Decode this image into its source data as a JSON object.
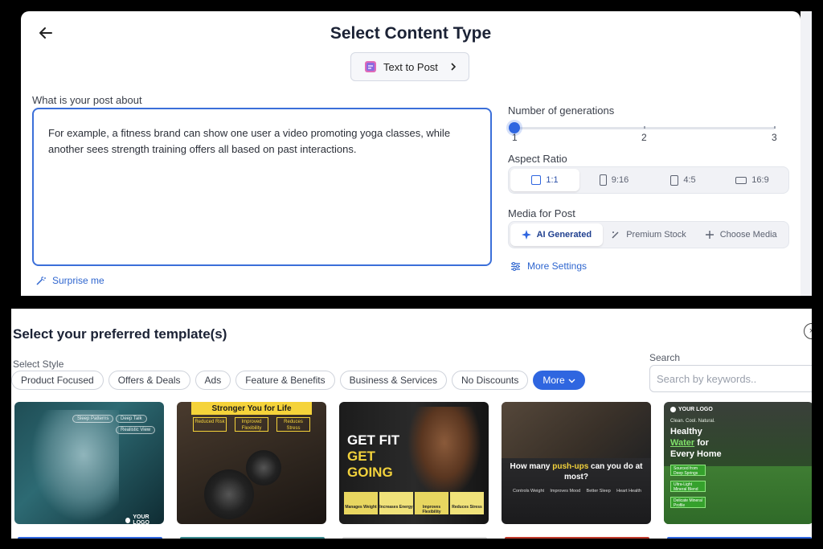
{
  "header": {
    "title": "Select Content Type",
    "content_type_button": "Text to Post"
  },
  "post": {
    "label": "What is your post about",
    "text": "For example, a fitness brand can show one user a video promoting yoga classes, while another sees strength training offers all based on past interactions.",
    "surprise_label": "Surprise me"
  },
  "generations": {
    "label": "Number of generations",
    "ticks": [
      "1",
      "2",
      "3"
    ],
    "value": 1
  },
  "aspect_ratio": {
    "label": "Aspect Ratio",
    "options": [
      "1:1",
      "9:16",
      "4:5",
      "16:9"
    ],
    "selected": "1:1"
  },
  "media": {
    "label": "Media for Post",
    "options": [
      "AI Generated",
      "Premium Stock",
      "Choose Media"
    ],
    "selected": "AI Generated"
  },
  "more_settings_label": "More Settings",
  "templates": {
    "title": "Select your preferred template(s)",
    "style_label": "Select Style",
    "search_label": "Search",
    "search_placeholder": "Search by keywords..",
    "styles": [
      "Product Focused",
      "Offers & Deals",
      "Ads",
      "Feature & Benefits",
      "Business & Services",
      "No Discounts"
    ],
    "more_label": "More",
    "cards": [
      {
        "pills": [
          "Sleep Patterns",
          "Deep Talk",
          "Realistic View"
        ],
        "logo": "YOUR LOGO"
      },
      {
        "banner": "Stronger You for Life",
        "boxes": [
          "Reduced Risk",
          "Improved Flexibility",
          "Reduces Stress"
        ]
      },
      {
        "headline": [
          "GET FIT",
          "GET",
          "GOING"
        ],
        "features": [
          "Manages Weight",
          "Increases Energy",
          "Improves Flexibility",
          "Reduces Stress"
        ]
      },
      {
        "question_pre": "How many ",
        "question_highlight": "push-ups",
        "question_post": " can you do at most?",
        "features": [
          "Controls Weight",
          "Improves Mood",
          "Better Sleep",
          "Heart Health"
        ]
      },
      {
        "logo": "YOUR LOGO",
        "tagline": "Clean. Cool. Natural.",
        "headline_1": "Healthy",
        "headline_2": "Water",
        "headline_3": " for",
        "headline_4": "Every Home",
        "buttons": [
          "Sourced from Deep Springs",
          "Ultra-Light Mineral Blend",
          "Delicate Mineral Profile"
        ]
      }
    ]
  },
  "colors": {
    "accent": "#2f66e0",
    "link": "#2f66cf",
    "yellow": "#f5d33a"
  }
}
